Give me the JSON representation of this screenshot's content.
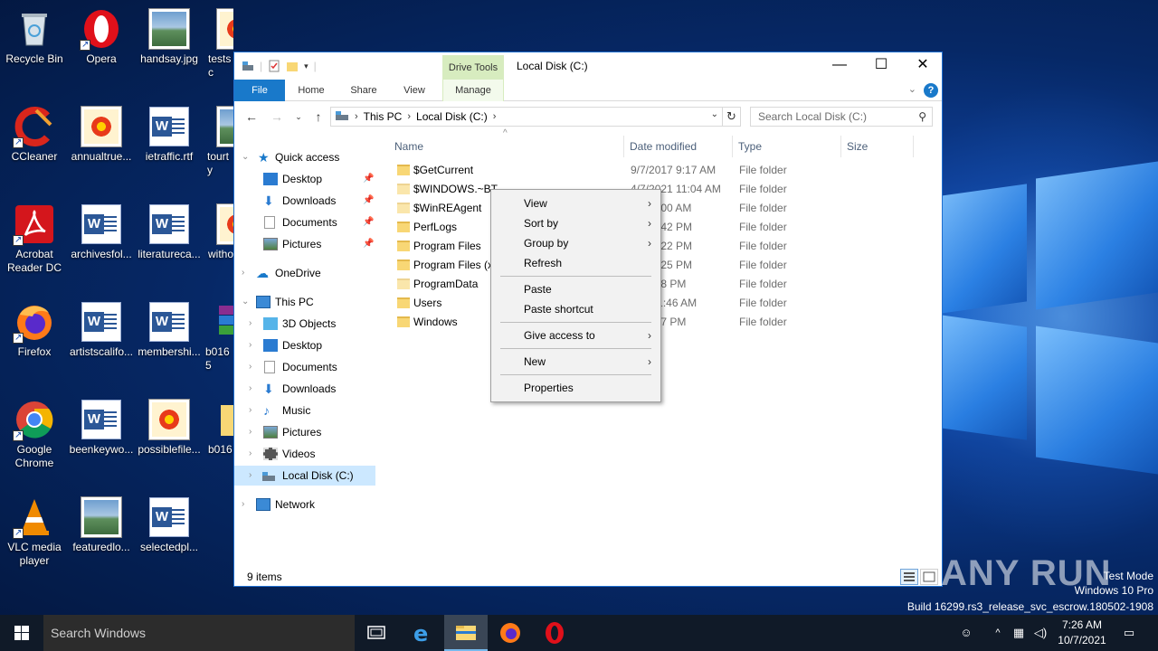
{
  "desktop": {
    "icons": [
      {
        "label": "Recycle Bin"
      },
      {
        "label": "Opera"
      },
      {
        "label": "handsay.jpg"
      },
      {
        "label": "testsc"
      },
      {
        "label": "CCleaner"
      },
      {
        "label": "annualtrue..."
      },
      {
        "label": "ietraffic.rtf"
      },
      {
        "label": "tourty"
      },
      {
        "label": "Acrobat Reader DC"
      },
      {
        "label": "archivesfol..."
      },
      {
        "label": "literatureca..."
      },
      {
        "label": "witho"
      },
      {
        "label": "Firefox"
      },
      {
        "label": "artistscalifo..."
      },
      {
        "label": "membershi..."
      },
      {
        "label": "b0165"
      },
      {
        "label": "Google Chrome"
      },
      {
        "label": "beenkeywo..."
      },
      {
        "label": "possiblefile..."
      },
      {
        "label": "b016"
      },
      {
        "label": "VLC media player"
      },
      {
        "label": "featuredlo..."
      },
      {
        "label": "selectedpl..."
      }
    ]
  },
  "window": {
    "title": "Local Disk (C:)",
    "contextual_tab_group": "Drive Tools",
    "ribbon_tabs": [
      "File",
      "Home",
      "Share",
      "View",
      "Manage"
    ],
    "help_glyph": "?",
    "address": {
      "root": "This PC",
      "current": "Local Disk (C:)"
    },
    "search_placeholder": "Search Local Disk (C:)",
    "nav": {
      "quick_access": "Quick access",
      "quick_items": [
        "Desktop",
        "Downloads",
        "Documents",
        "Pictures"
      ],
      "onedrive": "OneDrive",
      "this_pc": "This PC",
      "pc_items": [
        "3D Objects",
        "Desktop",
        "Documents",
        "Downloads",
        "Music",
        "Pictures",
        "Videos",
        "Local Disk (C:)"
      ],
      "network": "Network"
    },
    "columns": [
      "Name",
      "Date modified",
      "Type",
      "Size"
    ],
    "files": [
      {
        "name": "$GetCurrent",
        "date": "9/7/2017 9:17 AM",
        "type": "File folder"
      },
      {
        "name": "$WINDOWS.~BT",
        "date": "4/7/2021 11:04 AM",
        "type": "File folder"
      },
      {
        "name": "$WinREAgent",
        "date": "21 10:00 AM",
        "type": "File folder"
      },
      {
        "name": "PerfLogs",
        "date": "018 7:42 PM",
        "type": "File folder"
      },
      {
        "name": "Program Files",
        "date": "021 1:22 PM",
        "type": "File folder"
      },
      {
        "name": "Program Files (x8",
        "date": "021 1:25 PM",
        "type": "File folder"
      },
      {
        "name": "ProgramData",
        "date": "21 4:28 PM",
        "type": "File folder"
      },
      {
        "name": "Users",
        "date": "018 11:46 AM",
        "type": "File folder"
      },
      {
        "name": "Windows",
        "date": "21 3:47 PM",
        "type": "File folder"
      }
    ],
    "status": "9 items"
  },
  "context_menu": {
    "items": [
      "View",
      "Sort by",
      "Group by",
      "Refresh",
      "Paste",
      "Paste shortcut",
      "Give access to",
      "New",
      "Properties"
    ]
  },
  "taskbar": {
    "search_placeholder": "Search Windows",
    "time": "7:26 AM",
    "date": "10/7/2021"
  },
  "watermark": {
    "line1": "Test Mode",
    "line2": "Windows 10 Pro",
    "line3": "Build 16299.rs3_release_svc_escrow.180502-1908",
    "brand": "ANY RUN"
  },
  "colors": {
    "accent": "#1979ca",
    "drive_tools": "#d7ecbf",
    "selection": "#cce8ff",
    "folder": "#f8d775"
  }
}
